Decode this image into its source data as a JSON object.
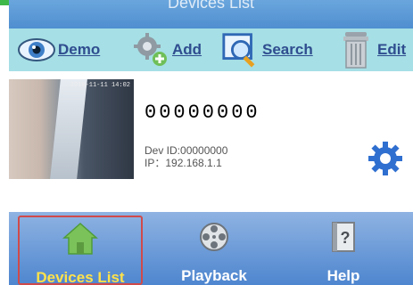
{
  "header": {
    "title": "Devices List"
  },
  "toolbar": {
    "items": [
      {
        "label": "Demo",
        "icon": "eye-icon"
      },
      {
        "label": "Add",
        "icon": "gear-add-icon"
      },
      {
        "label": "Search",
        "icon": "magnifier-icon"
      },
      {
        "label": "Edit",
        "icon": "trash-icon"
      }
    ]
  },
  "device": {
    "name": "00000000",
    "thumbnail_timestamp": "2019-11-11 14:02",
    "dev_id_label": "Dev ID:",
    "dev_id_value": "00000000",
    "ip_label": "IP：",
    "ip_value": "192.168.1.1",
    "settings_icon": "gear-icon"
  },
  "tabs": [
    {
      "label": "Devices List",
      "icon": "house-icon",
      "active": true
    },
    {
      "label": "Playback",
      "icon": "film-reel-icon",
      "active": false
    },
    {
      "label": "Help",
      "icon": "help-book-icon",
      "active": false
    }
  ],
  "colors": {
    "accent_green": "#3fb84a",
    "titlebar_blue": "#4f8ed0",
    "toolbar_bg": "#a6dfe5",
    "toolbar_text": "#2f4d8f",
    "tabbar_blue": "#4e86cf",
    "active_tab_text": "#ffe24a",
    "active_tab_border": "#d04a4a",
    "gear_blue": "#2f6fd0"
  }
}
